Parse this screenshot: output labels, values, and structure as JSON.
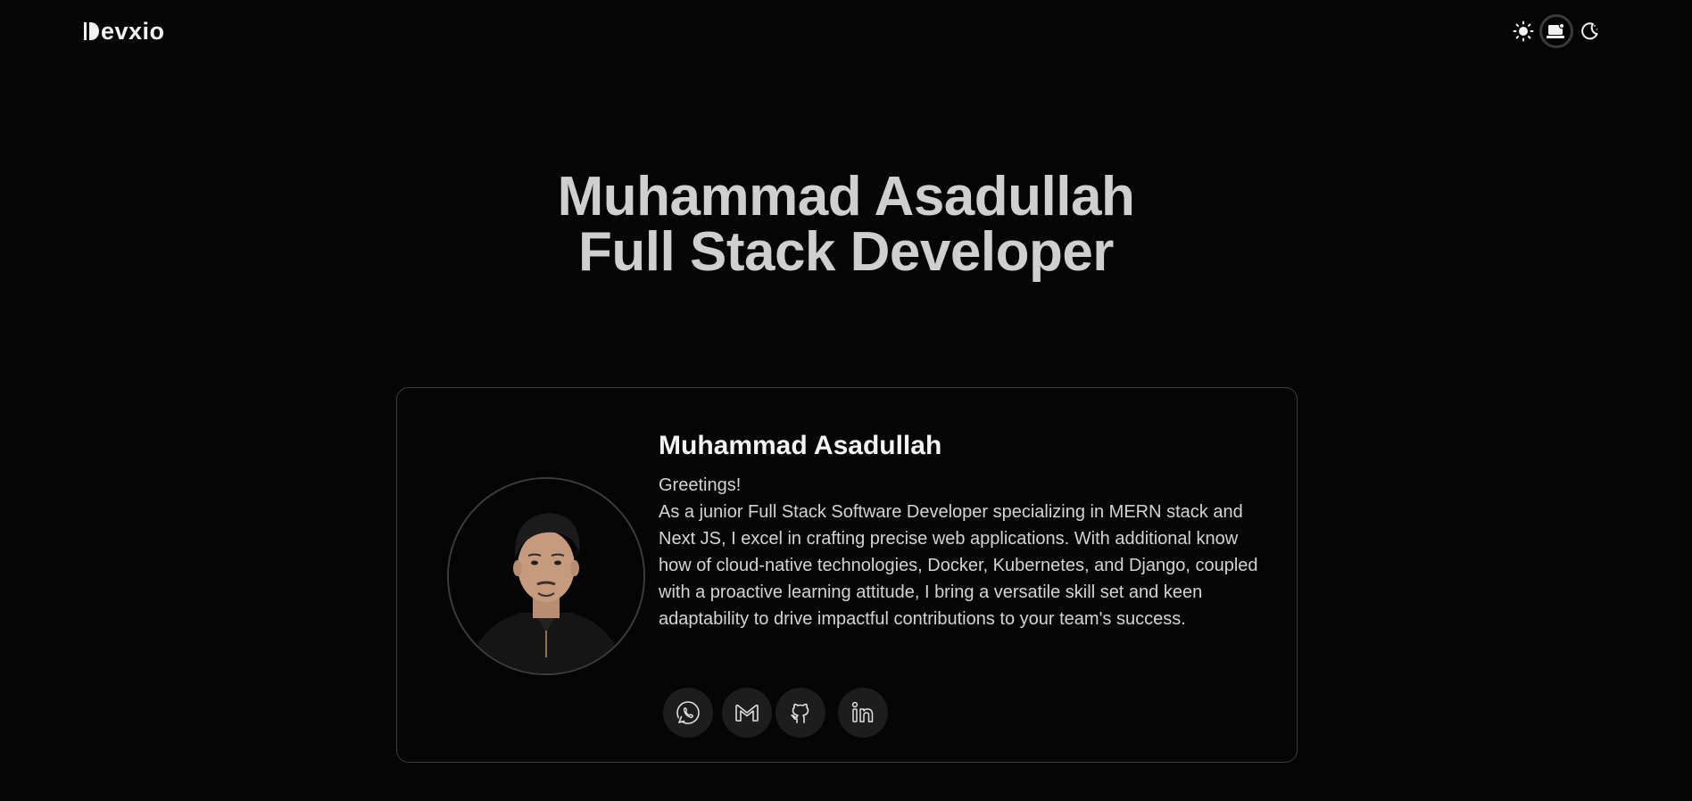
{
  "header": {
    "logo_text": "evxio",
    "theme_options": [
      {
        "icon": "sun-icon",
        "label": "Light"
      },
      {
        "icon": "monitor-icon",
        "label": "System",
        "active": true
      },
      {
        "icon": "moon-icon",
        "label": "Dark"
      }
    ]
  },
  "hero": {
    "line1": "Muhammad Asadullah",
    "line2": "Full Stack Developer"
  },
  "card": {
    "name": "Muhammad Asadullah",
    "greeting": "Greetings!",
    "bio": "As a junior Full Stack Software Developer specializing in MERN stack and Next JS, I excel in crafting precise web applications. With additional know how of cloud-native technologies, Docker, Kubernetes, and Django, coupled with a proactive learning attitude, I bring a versatile skill set and keen adaptability to drive impactful contributions to your team's success.",
    "socials": [
      {
        "icon": "whatsapp-icon"
      },
      {
        "icon": "gmail-icon"
      },
      {
        "icon": "github-icon"
      },
      {
        "icon": "linkedin-icon"
      }
    ]
  },
  "colors": {
    "background": "#050505",
    "text": "#d4d4d4",
    "heading": "#cfcfcf",
    "card_border": "#3c3c3c",
    "social_bg": "#1d1d1d"
  }
}
